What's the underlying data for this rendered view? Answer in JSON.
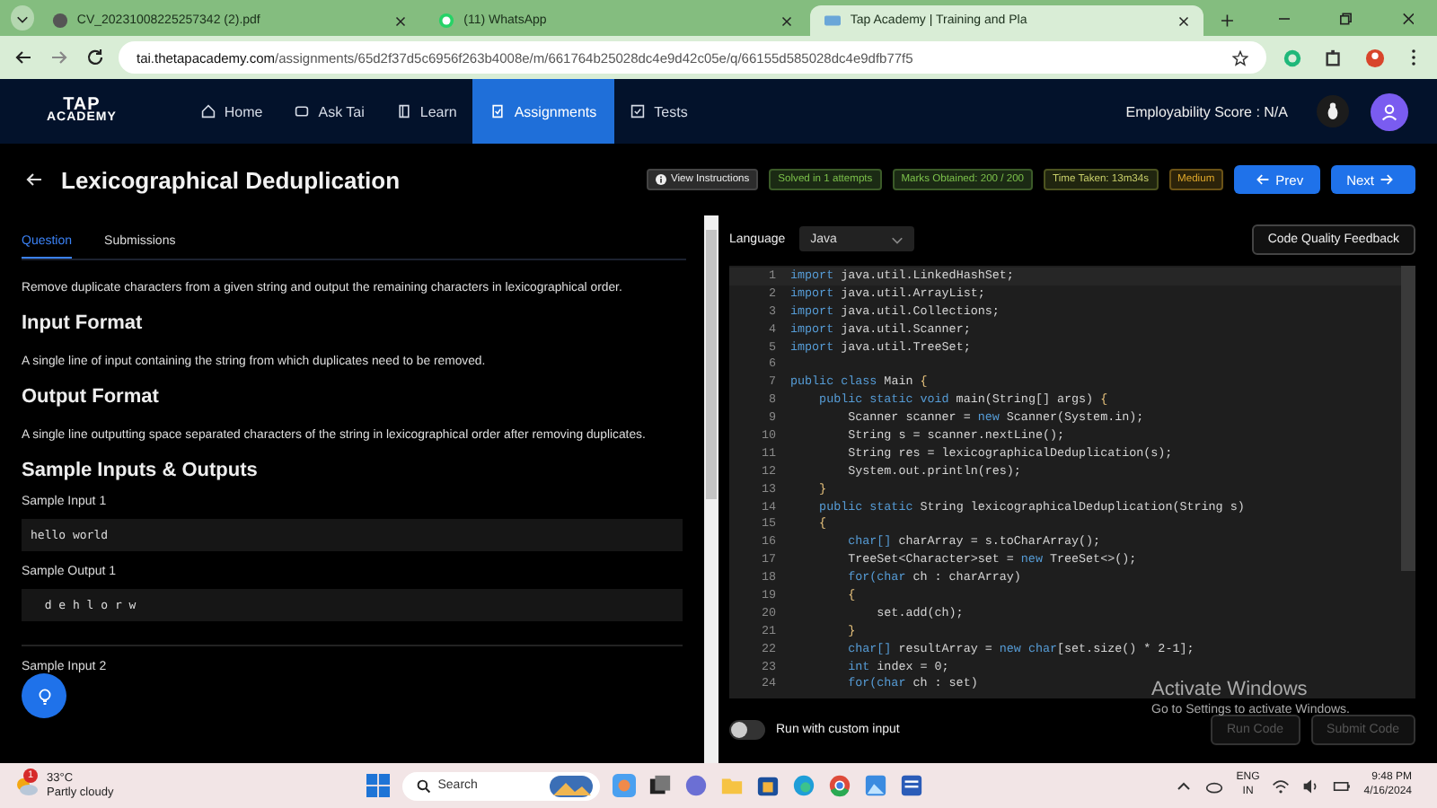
{
  "browser": {
    "tabs": [
      {
        "title": "CV_20231008225257342 (2).pdf",
        "kind": "pdf",
        "selected": false
      },
      {
        "title": "(11) WhatsApp",
        "kind": "chat",
        "selected": false
      },
      {
        "title": "Tap Academy | Training and Pla",
        "kind": "site",
        "selected": true
      }
    ],
    "url_host": "tai.thetapacademy.com",
    "url_path": "/assignments/65d2f37d5c6956f263b4008e/m/661764b25028dc4e9d42c05e/q/66155d585028dc4e9dfb77f5"
  },
  "nav": {
    "logo_top": "TAP",
    "logo_bottom": "ACADEMY",
    "items": [
      {
        "label": "Home",
        "kind": "home",
        "selected": false
      },
      {
        "label": "Ask Tai",
        "kind": "chat",
        "selected": false
      },
      {
        "label": "Learn",
        "kind": "book",
        "selected": false
      },
      {
        "label": "Assignments",
        "kind": "task",
        "selected": true
      },
      {
        "label": "Tests",
        "kind": "check",
        "selected": false
      }
    ],
    "score": "Employability Score : N/A"
  },
  "problem": {
    "title": "Lexicographical Deduplication",
    "badges": [
      {
        "text": "View Instructions",
        "kind": "info"
      },
      {
        "text": "Solved in 1 attempts",
        "kind": "success"
      },
      {
        "text": "Marks Obtained: 200 / 200",
        "kind": "success"
      },
      {
        "text": "Time Taken: 13m34s",
        "kind": "neutral"
      },
      {
        "text": "Medium",
        "kind": "warning"
      }
    ],
    "prev": "Prev",
    "next": "Next"
  },
  "panel_tabs": [
    {
      "label": "Question",
      "selected": true
    },
    {
      "label": "Submissions",
      "selected": false
    }
  ],
  "description": "Remove duplicate characters from a given string and output the remaining characters in lexicographical order.",
  "sections": [
    {
      "heading": "Input Format",
      "text": "A single line of input containing the string from which duplicates need to be removed."
    },
    {
      "heading": "Output Format",
      "text": "A single line outputting space separated characters of the string in lexicographical order after removing duplicates."
    }
  ],
  "samples_heading": "Sample Inputs & Outputs",
  "samples": [
    {
      "kind": "block",
      "label": "Sample Input 1",
      "value": "hello world"
    },
    {
      "kind": "block",
      "label": "Sample Output 1",
      "value": "  d e h l o r w"
    },
    {
      "kind": "label",
      "label": "Sample Input 2"
    }
  ],
  "editor": {
    "language_label": "Language",
    "language": "Java",
    "feedback": "Code Quality Feedback",
    "lines": [
      {
        "n": "1",
        "parts": [
          {
            "t": "import",
            "kind": "kw"
          },
          {
            "t": " java.util.LinkedHashSet;",
            "kind": "p"
          }
        ]
      },
      {
        "n": "2",
        "parts": [
          {
            "t": "import",
            "kind": "kw"
          },
          {
            "t": " java.util.ArrayList;",
            "kind": "p"
          }
        ]
      },
      {
        "n": "3",
        "parts": [
          {
            "t": "import",
            "kind": "kw"
          },
          {
            "t": " java.util.Collections;",
            "kind": "p"
          }
        ]
      },
      {
        "n": "4",
        "parts": [
          {
            "t": "import",
            "kind": "kw"
          },
          {
            "t": " java.util.Scanner;",
            "kind": "p"
          }
        ]
      },
      {
        "n": "5",
        "parts": [
          {
            "t": "import",
            "kind": "kw"
          },
          {
            "t": " java.util.TreeSet;",
            "kind": "p"
          }
        ]
      },
      {
        "n": "6"
      },
      {
        "n": "7",
        "parts": [
          {
            "t": "public class",
            "kind": "kw"
          },
          {
            "t": " Main ",
            "kind": "p"
          },
          {
            "t": "{",
            "kind": "br"
          }
        ]
      },
      {
        "n": "8",
        "parts": [
          {
            "t": "    public static void",
            "kind": "kw"
          },
          {
            "t": " main(String[] args) ",
            "kind": "p"
          },
          {
            "t": "{",
            "kind": "br"
          }
        ]
      },
      {
        "n": "9",
        "parts": [
          {
            "t": "        Scanner scanner = ",
            "kind": "p"
          },
          {
            "t": "new",
            "kind": "kw"
          },
          {
            "t": " Scanner(System.in);",
            "kind": "p"
          }
        ]
      },
      {
        "n": "10",
        "parts": [
          {
            "t": "        String s = scanner.nextLine();",
            "kind": "p"
          }
        ]
      },
      {
        "n": "11",
        "parts": [
          {
            "t": "        String res = lexicographicalDeduplication(s);",
            "kind": "p"
          }
        ]
      },
      {
        "n": "12",
        "parts": [
          {
            "t": "        System.out.println(res);",
            "kind": "p"
          }
        ]
      },
      {
        "n": "13",
        "parts": [
          {
            "t": "    }",
            "kind": "br"
          }
        ]
      },
      {
        "n": "14",
        "parts": [
          {
            "t": "    public static",
            "kind": "kw"
          },
          {
            "t": " String lexicographicalDeduplication(String s)",
            "kind": "p"
          }
        ]
      },
      {
        "n": "15",
        "parts": [
          {
            "t": "    {",
            "kind": "br"
          }
        ]
      },
      {
        "n": "16",
        "parts": [
          {
            "t": "        char[]",
            "kind": "kw"
          },
          {
            "t": " charArray = s.toCharArray();",
            "kind": "p"
          }
        ]
      },
      {
        "n": "17",
        "parts": [
          {
            "t": "        TreeSet<Character>set = ",
            "kind": "p"
          },
          {
            "t": "new",
            "kind": "kw"
          },
          {
            "t": " TreeSet<>();",
            "kind": "p"
          }
        ]
      },
      {
        "n": "18",
        "parts": [
          {
            "t": "        for(char",
            "kind": "kw"
          },
          {
            "t": " ch : charArray)",
            "kind": "p"
          }
        ]
      },
      {
        "n": "19",
        "parts": [
          {
            "t": "        {",
            "kind": "br"
          }
        ]
      },
      {
        "n": "20",
        "parts": [
          {
            "t": "            set.add(ch);",
            "kind": "p"
          }
        ]
      },
      {
        "n": "21",
        "parts": [
          {
            "t": "        }",
            "kind": "br"
          }
        ]
      },
      {
        "n": "22",
        "parts": [
          {
            "t": "        char[]",
            "kind": "kw"
          },
          {
            "t": " resultArray = ",
            "kind": "p"
          },
          {
            "t": "new char",
            "kind": "kw"
          },
          {
            "t": "[set.size() * 2-1];",
            "kind": "p"
          }
        ]
      },
      {
        "n": "23",
        "parts": [
          {
            "t": "        int",
            "kind": "kw"
          },
          {
            "t": " index = 0;",
            "kind": "p"
          }
        ]
      },
      {
        "n": "24",
        "parts": [
          {
            "t": "        for(char",
            "kind": "kw"
          },
          {
            "t": " ch : set)",
            "kind": "p"
          }
        ]
      }
    ],
    "custom_input": {
      "label": "Run with custom input",
      "on": false
    },
    "run": {
      "label": "Run Code",
      "disabled": true
    },
    "submit": {
      "label": "Submit Code",
      "disabled": true
    }
  },
  "activation": {
    "title": "Activate Windows",
    "subtitle": "Go to Settings to activate Windows."
  },
  "taskbar": {
    "alert": "1",
    "temperature": "33°C",
    "weather": "Partly cloudy",
    "search": "Search",
    "lang_top": "ENG",
    "lang_bottom": "IN",
    "time": "9:48 PM",
    "date": "4/16/2024"
  }
}
